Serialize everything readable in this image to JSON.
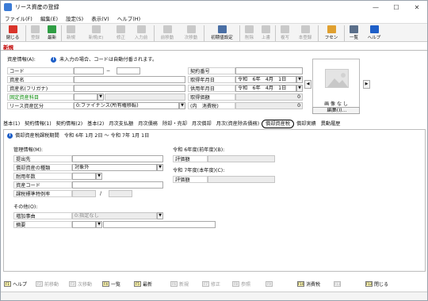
{
  "window": {
    "title": "リース資産の登録"
  },
  "menu": [
    "ファイル(F)",
    "編集(E)",
    "設定(S)",
    "表示(V)",
    "ヘルプ(H)"
  ],
  "toolbar": [
    {
      "label": "閉じる",
      "icon": "close-door-icon",
      "color": "#d9342b",
      "enabled": true
    },
    {
      "label": "登録",
      "icon": "save-icon",
      "color": "#c9c9c9",
      "enabled": false
    },
    {
      "label": "最新",
      "icon": "refresh-icon",
      "color": "#2f9e44",
      "enabled": true
    },
    {
      "label": "新規",
      "icon": "new-doc-icon",
      "color": "#c9c9c9",
      "enabled": false
    },
    {
      "label": "新規(E)",
      "icon": "new-copy-icon",
      "color": "#c9c9c9",
      "enabled": false
    },
    {
      "label": "修正",
      "icon": "edit-icon",
      "color": "#c9c9c9",
      "enabled": false
    },
    {
      "label": "入力前",
      "icon": "undo-icon",
      "color": "#c9c9c9",
      "enabled": false
    },
    {
      "label": "前移動",
      "icon": "prev-icon",
      "color": "#c9c9c9",
      "enabled": false
    },
    {
      "label": "次移動",
      "icon": "next-icon",
      "color": "#c9c9c9",
      "enabled": false
    },
    {
      "label": "初期値設定",
      "icon": "defaults-icon",
      "color": "#4a6fa5",
      "enabled": true
    },
    {
      "label": "削除",
      "icon": "delete-icon",
      "color": "#c9c9c9",
      "enabled": false
    },
    {
      "label": "上書",
      "icon": "overwrite-icon",
      "color": "#c9c9c9",
      "enabled": false
    },
    {
      "label": "複写",
      "icon": "copy-icon",
      "color": "#c9c9c9",
      "enabled": false
    },
    {
      "label": "本登録",
      "icon": "register-icon",
      "color": "#c9c9c9",
      "enabled": false
    },
    {
      "label": "フセン",
      "icon": "sticky-note-icon",
      "color": "#e0a030",
      "enabled": true
    },
    {
      "label": "一覧",
      "icon": "list-icon",
      "color": "#5b6f8a",
      "enabled": true
    },
    {
      "label": "ヘルプ",
      "icon": "help-icon",
      "color": "#1e5fc8",
      "enabled": true
    }
  ],
  "mode": "新規",
  "asset_info": {
    "header": "資産情報(A):",
    "notice": "未入力の場合、コードは自動付番されます。",
    "code_label": "コード",
    "code_sep": "−",
    "name_label": "資産名",
    "kana_label": "資産名(フリガナ)",
    "account_label": "固定資産科目",
    "category_label": "リース資産区分",
    "category_value": "0:ファイナンス(所有権移転)"
  },
  "contract": {
    "number_label": "契約番号",
    "acquired_label": "取得年月日",
    "acquired_value": "令和　6年　4月　1日",
    "in_use_label": "供用年月日",
    "in_use_value": "令和　6年　4月　1日",
    "cost_label": "取得価額",
    "cost_value": "0",
    "tax_label": "(内　消費税)",
    "tax_value": "0"
  },
  "image": {
    "caption": "画 像 な し",
    "edit_label": "編集(I)..."
  },
  "tabs": [
    {
      "label": "基本(1)",
      "active": false
    },
    {
      "label": "契約情報(1)",
      "active": false
    },
    {
      "label": "契約情報(2)",
      "active": false
    },
    {
      "label": "基本(2)",
      "active": false
    },
    {
      "label": "月次支払額",
      "active": false
    },
    {
      "label": "月次債務",
      "active": false
    },
    {
      "label": "除却・売却",
      "active": false
    },
    {
      "label": "月次償却",
      "active": false
    },
    {
      "label": "月次(資産除去債務)",
      "active": false
    },
    {
      "label": "償却資産税",
      "active": true
    },
    {
      "label": "償却実績",
      "active": false
    },
    {
      "label": "異動履歴",
      "active": false
    }
  ],
  "panel": {
    "period_title": "償却資産税課税期間　令和 6年 1月 2日 〜 令和 7年 1月 1日",
    "mgmt_header": "管理情報(M):",
    "submit_label": "提出先",
    "type_label": "償却資産の種類",
    "type_value": "対象外",
    "life_label": "耐用年数",
    "asset_code_label": "資産コード",
    "rate_label": "課税標準特例率",
    "rate_sep": "/",
    "fy_prev_header": "令和 6年度(前年度)(B):",
    "fy_prev_label": "評価額",
    "fy_curr_header": "令和 7年度(本年度)(C):",
    "fy_curr_label": "評価額",
    "other_header": "その他(O):",
    "reason_label": "増加事由",
    "reason_value": "0:指定なし",
    "summary_label": "摘要"
  },
  "fkeys": [
    {
      "key": "F1",
      "label": "ヘルプ",
      "enabled": true
    },
    {
      "key": "F2",
      "label": "前移動",
      "enabled": false
    },
    {
      "key": "F3",
      "label": "次移動",
      "enabled": false
    },
    {
      "key": "F4",
      "label": "一覧",
      "enabled": true
    },
    {
      "key": "F5",
      "label": "最新",
      "enabled": true
    },
    {
      "key": "F6",
      "label": "新規",
      "enabled": false
    },
    {
      "key": "F7",
      "label": "修正",
      "enabled": false
    },
    {
      "key": "F8",
      "label": "参照",
      "enabled": false
    },
    {
      "key": "F9",
      "label": "",
      "enabled": false
    },
    {
      "key": "F10",
      "label": "消費税",
      "enabled": true
    },
    {
      "key": "F11",
      "label": "",
      "enabled": false
    },
    {
      "key": "F12",
      "label": "閉じる",
      "enabled": true
    }
  ]
}
